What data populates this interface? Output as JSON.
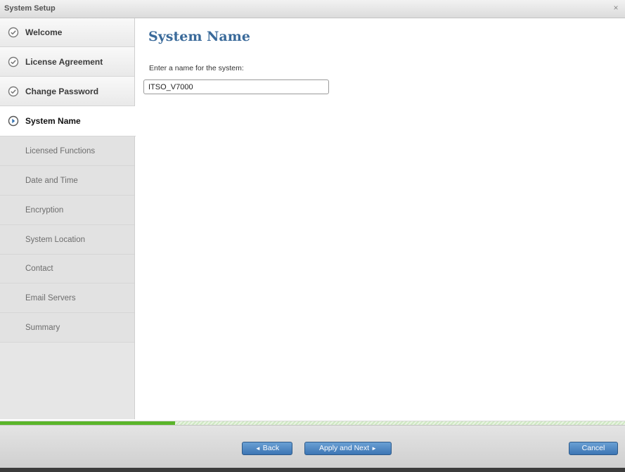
{
  "window": {
    "title": "System Setup",
    "close_glyph": "×"
  },
  "sidebar": {
    "items": [
      {
        "label": "Welcome",
        "state": "done",
        "icon": "check-circle-icon"
      },
      {
        "label": "License Agreement",
        "state": "done",
        "icon": "check-circle-icon"
      },
      {
        "label": "Change Password",
        "state": "done",
        "icon": "check-circle-icon"
      },
      {
        "label": "System Name",
        "state": "active",
        "icon": "arrow-circle-icon"
      },
      {
        "label": "Licensed Functions",
        "state": "pending"
      },
      {
        "label": "Date and Time",
        "state": "pending"
      },
      {
        "label": "Encryption",
        "state": "pending"
      },
      {
        "label": "System Location",
        "state": "pending"
      },
      {
        "label": "Contact",
        "state": "pending"
      },
      {
        "label": "Email Servers",
        "state": "pending"
      },
      {
        "label": "Summary",
        "state": "pending"
      }
    ]
  },
  "main": {
    "title": "System Name",
    "field_label": "Enter a name for the system:",
    "system_name_value": "ITSO_V7000"
  },
  "progress": {
    "fraction": 0.28
  },
  "footer": {
    "back_label": "Back",
    "back_glyph": "◄",
    "next_label": "Apply and Next",
    "next_glyph": "►",
    "cancel_label": "Cancel"
  },
  "colors": {
    "accent_title": "#3a6a9a",
    "button_blue": "#3c75b4",
    "progress_green": "#5ab52a",
    "check_gray": "#7a7a7a",
    "active_blue": "#2f6fb0"
  }
}
